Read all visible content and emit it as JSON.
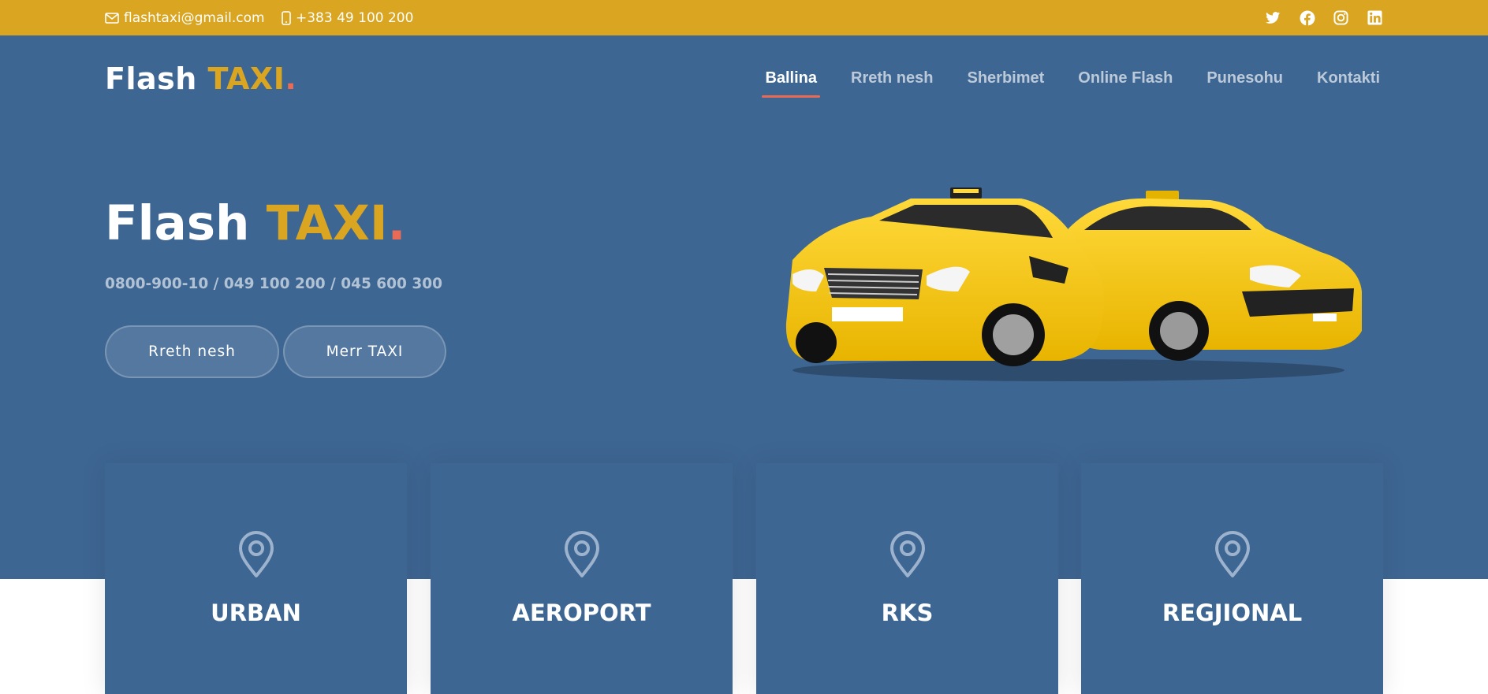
{
  "topbar": {
    "email": "flashtaxi@gmail.com",
    "phone": "+383 49 100 200",
    "email_icon": "envelope-icon",
    "phone_icon": "mobile-phone-icon",
    "social": [
      "twitter-icon",
      "facebook-icon",
      "instagram-icon",
      "linkedin-icon"
    ]
  },
  "logo": {
    "text": "Flash ",
    "accent": "TAXI",
    "dot": "."
  },
  "nav": {
    "items": [
      {
        "label": "Ballina",
        "active": true
      },
      {
        "label": "Rreth nesh"
      },
      {
        "label": "Sherbimet"
      },
      {
        "label": "Online Flash"
      },
      {
        "label": "Punesohu"
      },
      {
        "label": "Kontakti"
      }
    ]
  },
  "hero": {
    "title": "Flash ",
    "title_accent": "TAXI",
    "title_dot": ".",
    "phones": "0800-900-10 / 049 100 200 / 045 600 300",
    "buttons": {
      "about": "Rreth nesh",
      "taxi": "Merr TAXI"
    }
  },
  "services": [
    {
      "title": "URBAN",
      "icon": "map-pin-icon"
    },
    {
      "title": "AEROPORT",
      "icon": "map-pin-icon"
    },
    {
      "title": "RKS",
      "icon": "map-pin-icon"
    },
    {
      "title": "REGJIONAL",
      "icon": "map-pin-icon"
    }
  ],
  "colors": {
    "primary": "#3e6693",
    "accent": "#daa520",
    "dot": "#e96b56"
  }
}
